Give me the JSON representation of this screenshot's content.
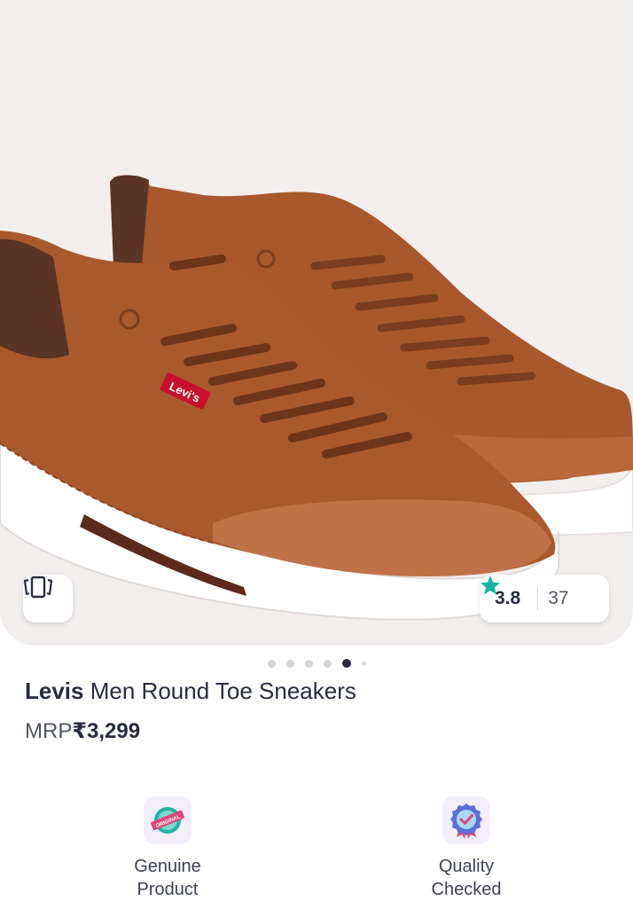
{
  "product": {
    "brand": "Levis",
    "name": "Men Round Toe Sneakers",
    "mrp_label": "MRP",
    "mrp_value": "₹3,299",
    "image_logo_text": "Levi's"
  },
  "rating": {
    "value": "3.8",
    "count": "37",
    "star_color": "#14b5a4"
  },
  "carousel": {
    "total_slides": 6,
    "active_index": 4
  },
  "assurances": [
    {
      "icon": "original-seal-icon",
      "line1": "Genuine",
      "line2": "Product"
    },
    {
      "icon": "quality-badge-icon",
      "line1": "Quality",
      "line2": "Checked"
    }
  ],
  "colors": {
    "hero_bg": "#f2eeee",
    "text_primary": "#282c3f",
    "accent_teal": "#14b5a4",
    "shoe_leather": "#a9592e"
  }
}
